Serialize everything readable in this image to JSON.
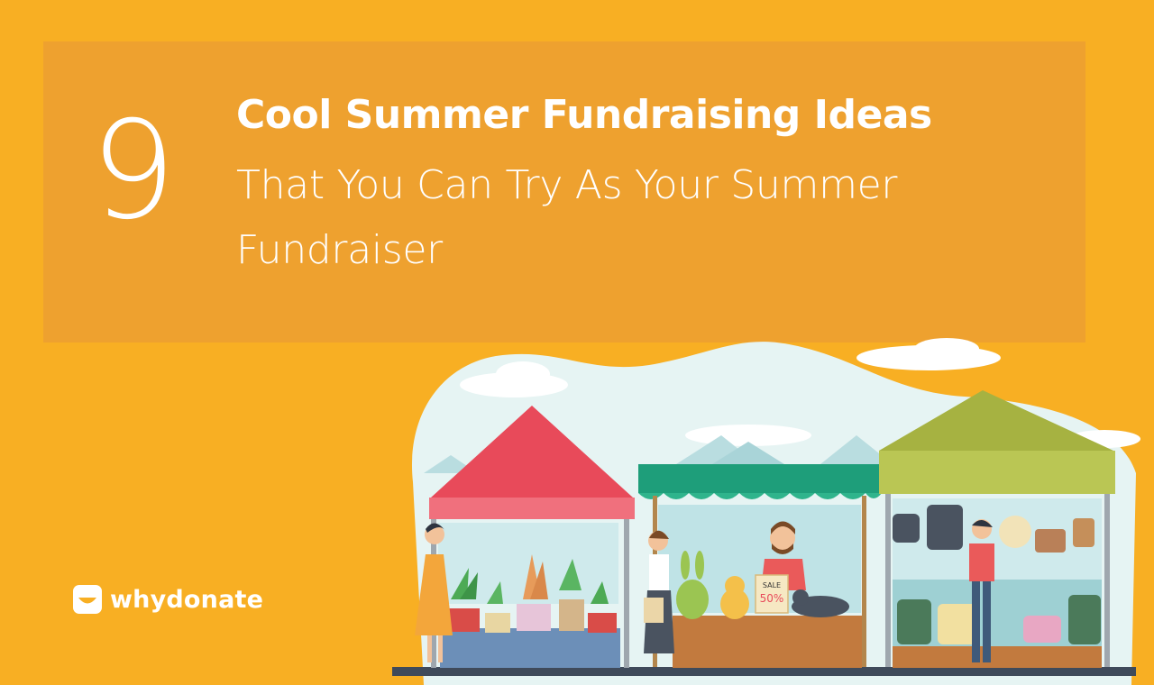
{
  "banner": {
    "number": "9",
    "title_line1": "Cool Summer Fundraising Ideas",
    "title_line2": "That You Can Try As Your Summer",
    "title_line3": "Fundraiser"
  },
  "brand": {
    "name": "whydonate"
  },
  "scene": {
    "sign_top": "SALE",
    "sign_bottom": "50%"
  },
  "colors": {
    "background": "#F8AF23",
    "banner": "#EEA12F",
    "red_tent": "#E84A5A",
    "green_awning": "#1E9E7A",
    "olive_tent": "#A6B241"
  }
}
